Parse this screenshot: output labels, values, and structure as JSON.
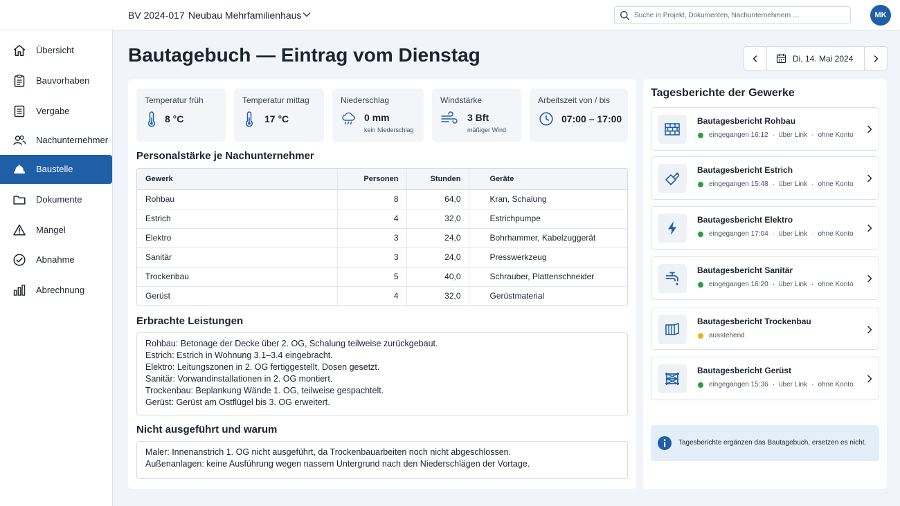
{
  "colors": {
    "accent": "#1f5fa8",
    "status_green": "#2e9d3f",
    "status_yellow": "#e7b416"
  },
  "topbar": {
    "project_code": "BV 2024-017",
    "project_name": "Neubau Mehrfamilienhaus",
    "search_placeholder": "Suche in Projekt, Dokumenten, Nachunternehmern …",
    "avatar_initials": "MK"
  },
  "sidebar": {
    "items": [
      {
        "label": "Übersicht",
        "icon": "home-icon"
      },
      {
        "label": "Bauvorhaben",
        "icon": "clipboard-icon"
      },
      {
        "label": "Vergabe",
        "icon": "document-icon"
      },
      {
        "label": "Nachunternehmer",
        "icon": "users-icon"
      },
      {
        "label": "Baustelle",
        "icon": "hardhat-icon",
        "active": true
      },
      {
        "label": "Dokumente",
        "icon": "folder-icon"
      },
      {
        "label": "Mängel",
        "icon": "warning-icon"
      },
      {
        "label": "Abnahme",
        "icon": "check-circle-icon"
      },
      {
        "label": "Abrechnung",
        "icon": "bar-chart-icon"
      }
    ]
  },
  "header": {
    "title": "Bautagebuch — Eintrag vom Dienstag",
    "date": "Di, 14. Mai 2024"
  },
  "weather": {
    "temp_morning": {
      "title": "Temperatur früh",
      "value": "8 °C",
      "icon": "thermometer-icon"
    },
    "temp_noon": {
      "title": "Temperatur mittag",
      "value": "17 °C",
      "icon": "thermometer-icon"
    },
    "precipitation": {
      "title": "Niederschlag",
      "value": "0 mm",
      "sub": "kein Niederschlag",
      "icon": "rain-cloud-icon"
    },
    "wind": {
      "title": "Windstärke",
      "value": "3 Bft",
      "sub": "mäßiger Wind",
      "icon": "wind-icon"
    },
    "work_time": {
      "title": "Arbeitszeit von / bis",
      "value": "07:00 – 17:00",
      "icon": "clock-icon"
    }
  },
  "staff": {
    "title": "Personalstärke je Nachunternehmer",
    "headers": [
      "Gewerk",
      "Personen",
      "Stunden",
      "Geräte"
    ],
    "rows": [
      [
        "Rohbau",
        "8",
        "64,0",
        "Kran, Schalung"
      ],
      [
        "Estrich",
        "4",
        "32,0",
        "Estrichpumpe"
      ],
      [
        "Elektro",
        "3",
        "24,0",
        "Bohrhammer, Kabelzuggerät"
      ],
      [
        "Sanitär",
        "3",
        "24,0",
        "Presswerkzeug"
      ],
      [
        "Trockenbau",
        "5",
        "40,0",
        "Schrauber, Plattenschneider"
      ],
      [
        "Gerüst",
        "4",
        "32,0",
        "Gerüstmaterial"
      ]
    ]
  },
  "performed": {
    "title": "Erbrachte Leistungen",
    "lines": [
      "Rohbau: Betonage der Decke über 2. OG, Schalung teilweise zurückgebaut.",
      "Estrich: Estrich in Wohnung 3.1–3.4 eingebracht.",
      "Elektro: Leitungszonen in 2. OG fertiggestellt, Dosen gesetzt.",
      "Sanitär: Vorwandinstallationen in 2. OG montiert.",
      "Trockenbau: Beplankung Wände 1. OG, teilweise gespachtelt.",
      "Gerüst: Gerüst am Ostflügel bis 3. OG erweitert."
    ]
  },
  "not_performed": {
    "title": "Nicht ausgeführt und warum",
    "lines": [
      "Maler: Innenanstrich 1. OG nicht ausgeführt, da Trockenbauarbeiten noch nicht abgeschlossen.",
      "Außenanlagen: keine Ausführung wegen nassem Untergrund nach den Niederschlägen der Vortage."
    ]
  },
  "reports": {
    "title": "Tagesberichte der Gewerke",
    "items": [
      {
        "name": "Bautagesbericht Rohbau",
        "status": "eingegangen 16:12",
        "via": "über Link",
        "account": "ohne Konto",
        "state": "green",
        "icon": "brick-wall-icon"
      },
      {
        "name": "Bautagesbericht Estrich",
        "status": "eingegangen 15:48",
        "via": "über Link",
        "account": "ohne Konto",
        "state": "green",
        "icon": "trowel-icon"
      },
      {
        "name": "Bautagesbericht Elektro",
        "status": "eingegangen 17:04",
        "via": "über Link",
        "account": "ohne Konto",
        "state": "green",
        "icon": "lightning-icon"
      },
      {
        "name": "Bautagesbericht Sanitär",
        "status": "eingegangen 16:20",
        "via": "über Link",
        "account": "ohne Konto",
        "state": "green",
        "icon": "faucet-icon"
      },
      {
        "name": "Bautagesbericht Trockenbau",
        "status": "ausstehend",
        "state": "yellow",
        "icon": "drywall-panel-icon"
      },
      {
        "name": "Bautagesbericht Gerüst",
        "status": "eingegangen 15:36",
        "via": "über Link",
        "account": "ohne Konto",
        "state": "green",
        "icon": "scaffold-icon"
      }
    ],
    "info": "Tagesberichte ergänzen das Bautagebuch, ersetzen es nicht."
  }
}
